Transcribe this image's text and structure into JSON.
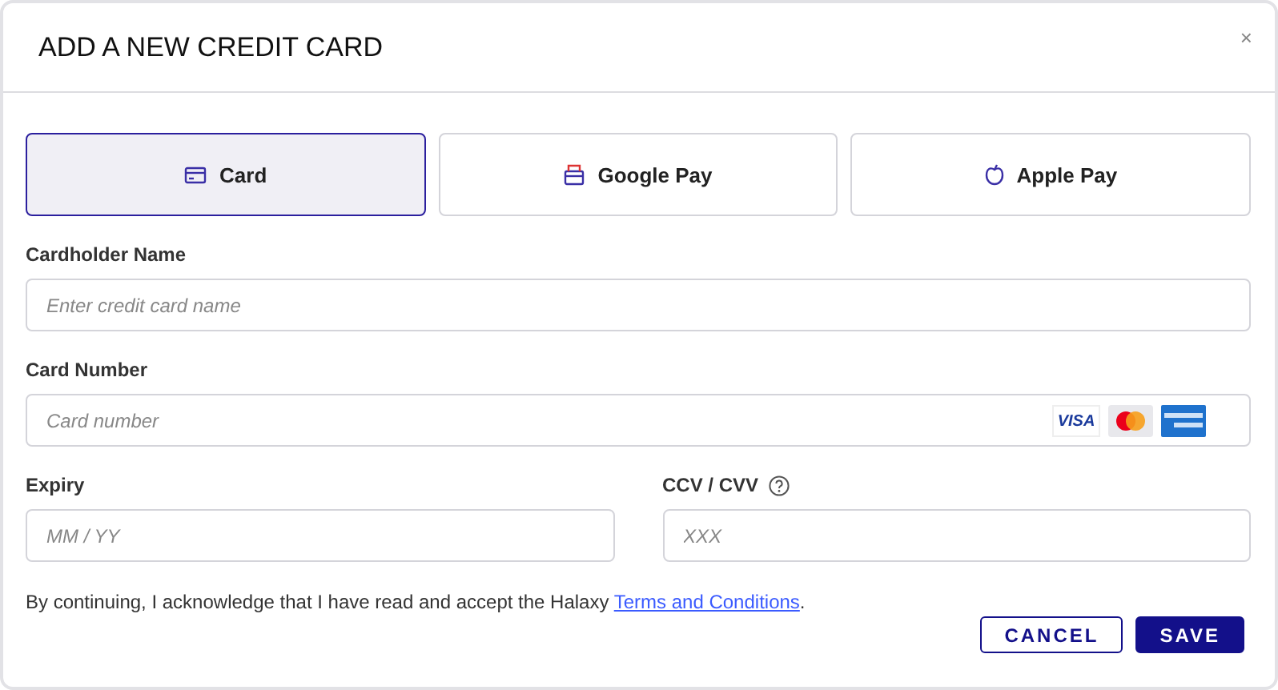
{
  "dialog": {
    "title": "ADD A NEW CREDIT CARD",
    "close": "×"
  },
  "methods": [
    {
      "kind": "card",
      "label": "Card",
      "selected": true
    },
    {
      "kind": "wallet",
      "label": "Google Pay",
      "selected": false
    },
    {
      "kind": "apple",
      "label": "Apple Pay",
      "selected": false
    }
  ],
  "fields": [
    {
      "label": "Cardholder Name",
      "placeholder": "Enter credit card name"
    },
    {
      "label": "Card Number",
      "placeholder": "Card number",
      "brands": [
        {
          "kind": "visa",
          "text": "VISA"
        },
        {
          "kind": "mastercard"
        },
        {
          "kind": "amex"
        }
      ]
    }
  ],
  "row": [
    {
      "label": "Expiry",
      "placeholder": "MM / YY",
      "help": false
    },
    {
      "label": "CCV / CVV",
      "placeholder": "XXX",
      "help": true
    }
  ],
  "consent": {
    "text": "By continuing, I acknowledge that I have read and accept the Halaxy",
    "link": "Terms and Conditions",
    "after": "."
  },
  "buttons": [
    {
      "kind": "secondary",
      "label": "CANCEL"
    },
    {
      "kind": "primary",
      "label": "SAVE"
    }
  ]
}
